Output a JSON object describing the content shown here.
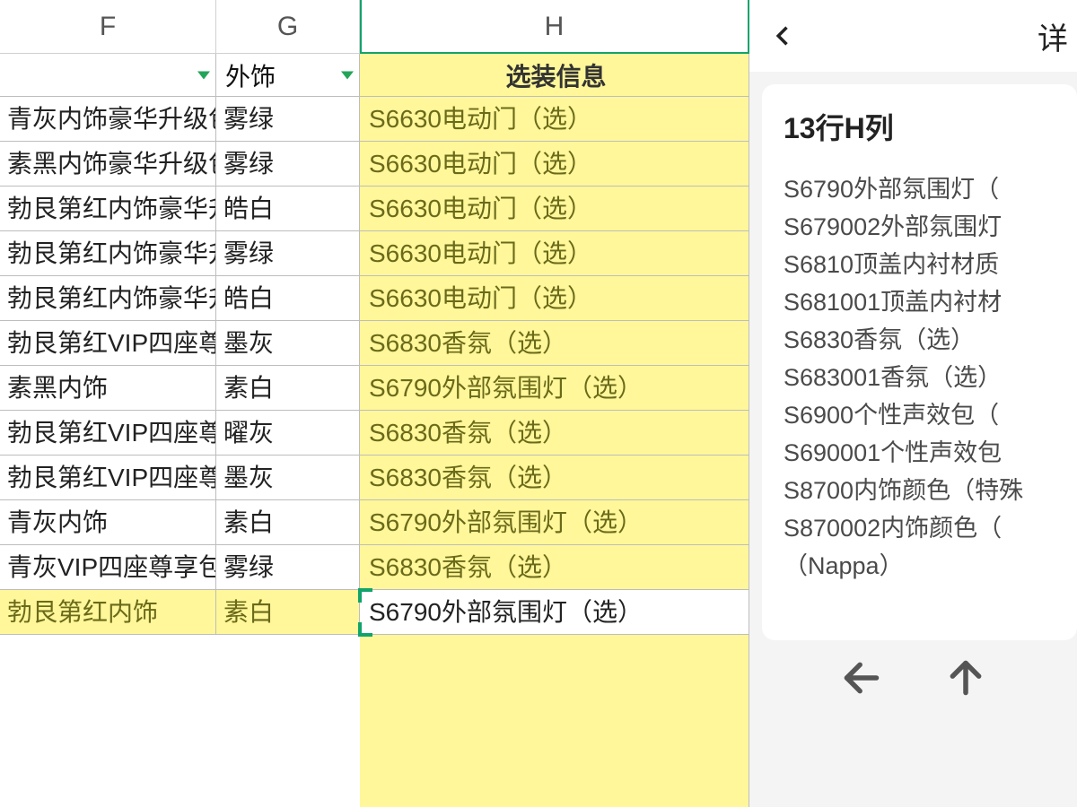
{
  "columns": {
    "F": "F",
    "G": "G",
    "H": "H"
  },
  "headers": {
    "F": "",
    "G": "外饰",
    "H": "选装信息"
  },
  "rows": [
    {
      "f": "青灰内饰豪华升级包",
      "g": "雾绿",
      "h": "S6630电动门（选）"
    },
    {
      "f": "素黑内饰豪华升级包",
      "g": "雾绿",
      "h": "S6630电动门（选）"
    },
    {
      "f": "勃艮第红内饰豪华升约",
      "g": "皓白",
      "h": "S6630电动门（选）"
    },
    {
      "f": "勃艮第红内饰豪华升约",
      "g": "雾绿",
      "h": "S6630电动门（选）"
    },
    {
      "f": "勃艮第红内饰豪华升约",
      "g": "皓白",
      "h": "S6630电动门（选）"
    },
    {
      "f": "勃艮第红VIP四座尊享",
      "g": "墨灰",
      "h": "S6830香氛（选）"
    },
    {
      "f": "素黑内饰",
      "g": "素白",
      "h": "S6790外部氛围灯（选）"
    },
    {
      "f": "勃艮第红VIP四座尊享",
      "g": "曜灰",
      "h": "S6830香氛（选）"
    },
    {
      "f": "勃艮第红VIP四座尊享",
      "g": "墨灰",
      "h": "S6830香氛（选）"
    },
    {
      "f": "青灰内饰",
      "g": "素白",
      "h": "S6790外部氛围灯（选）"
    },
    {
      "f": "青灰VIP四座尊享包",
      "g": "雾绿",
      "h": "S6830香氛（选）"
    },
    {
      "f": "勃艮第红内饰",
      "g": "素白",
      "h": "S6790外部氛围灯（选）"
    }
  ],
  "selected_row_index": 11,
  "panel": {
    "back_label": "返回",
    "title": "详",
    "card_title": "13行H列",
    "lines": [
      "S6790外部氛围灯（",
      "S679002外部氛围灯",
      "S6810顶盖内衬材质",
      "S681001顶盖内衬材",
      "S6830香氛（选）",
      "S683001香氛（选）",
      "S6900个性声效包（",
      "S690001个性声效包",
      "S8700内饰颜色（特殊",
      "S870002内饰颜色（",
      "（Nappa）"
    ]
  }
}
